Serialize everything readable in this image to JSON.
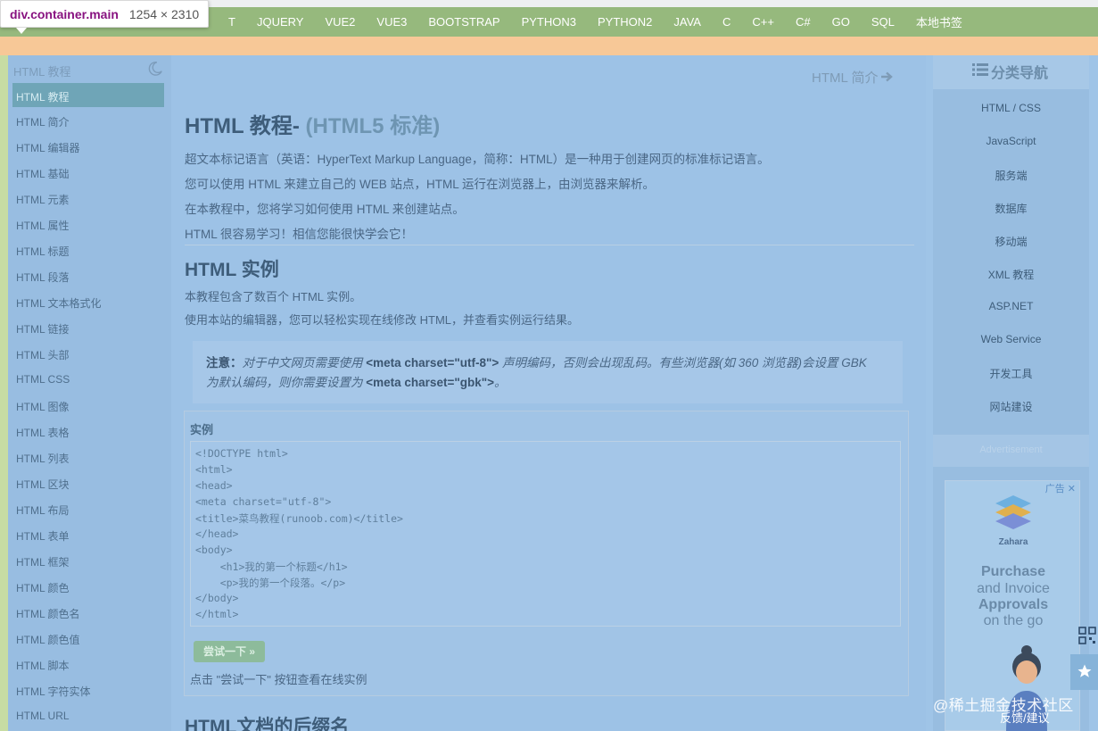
{
  "devtools": {
    "selector": "div.container.main",
    "dimensions": "1254 × 2310"
  },
  "topnav": [
    "T",
    "JQUERY",
    "VUE2",
    "VUE3",
    "BOOTSTRAP",
    "PYTHON3",
    "PYTHON2",
    "JAVA",
    "C",
    "C++",
    "C#",
    "GO",
    "SQL",
    "本地书签"
  ],
  "sidebar": {
    "title": "HTML 教程",
    "active": "HTML 教程",
    "items": [
      "HTML 简介",
      "HTML 编辑器",
      "HTML 基础",
      "HTML 元素",
      "HTML 属性",
      "HTML 标题",
      "HTML 段落",
      "HTML 文本格式化",
      "HTML 链接",
      "HTML 头部",
      "HTML CSS",
      "HTML 图像",
      "HTML 表格",
      "HTML 列表",
      "HTML 区块",
      "HTML 布局",
      "HTML 表单",
      "HTML 框架",
      "HTML 颜色",
      "HTML 颜色名",
      "HTML 颜色值",
      "HTML 脚本",
      "HTML 字符实体",
      "HTML URL"
    ]
  },
  "main": {
    "next_link": "HTML 简介",
    "title": "HTML 教程-",
    "title_sub": "(HTML5 标准)",
    "intro": [
      "超文本标记语言（英语：HyperText Markup Language，简称：HTML）是一种用于创建网页的标准标记语言。",
      "您可以使用 HTML 来建立自己的 WEB 站点，HTML 运行在浏览器上，由浏览器来解析。",
      "在本教程中，您将学习如何使用 HTML 来创建站点。",
      "HTML 很容易学习！相信您能很快学会它！"
    ],
    "h2": "HTML 实例",
    "examples_text": [
      "本教程包含了数百个 HTML 实例。",
      "使用本站的编辑器，您可以轻松实现在线修改 HTML，并查看实例运行结果。"
    ],
    "note": {
      "prefix": "注意：",
      "line1_a": "对于中文网页需要使用 ",
      "line1_b": "<meta charset=\"utf-8\">",
      "line1_c": " 声明编码，否则会出现乱码。有些浏览器(如 360 浏览器)会设置 GBK",
      "line2_a": "为默认编码，则你需要设置为 ",
      "line2_b": "<meta charset=\"gbk\">",
      "line2_c": "。"
    },
    "example_label": "实例",
    "code_lines": [
      "<!DOCTYPE html>",
      "<html>",
      "<head>",
      "<meta charset=\"utf-8\">",
      "<title>菜鸟教程(runoob.com)</title>",
      "</head>",
      "<body>",
      "    <h1>我的第一个标题</h1>",
      "    <p>我的第一个段落。</p>",
      "</body>",
      "</html>"
    ],
    "try_button": "尝试一下 »",
    "try_caption": "点击 \"尝试一下\" 按钮查看在线实例",
    "h2_next": "HTML文档的后缀名"
  },
  "rightnav": {
    "header": "分类导航",
    "items": [
      "HTML / CSS",
      "JavaScript",
      "服务端",
      "数据库",
      "移动端",
      "XML 教程",
      "ASP.NET",
      "Web Service",
      "开发工具",
      "网站建设"
    ],
    "ad_header": "Advertisement"
  },
  "ad": {
    "tag": "广告 ✕",
    "brand": "Zahara",
    "lines": [
      "Purchase",
      "and Invoice",
      "Approvals",
      "on the go"
    ]
  },
  "feedback": "反馈/建议",
  "watermark": "@稀土掘金技术社区"
}
